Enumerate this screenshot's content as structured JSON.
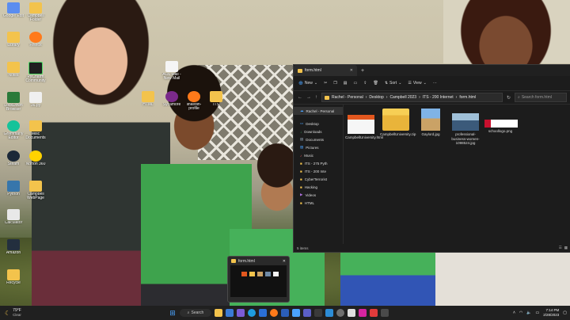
{
  "desktop": {
    "icons": [
      {
        "label": "Google Edit",
        "icon": "google-doc-icon",
        "color": "#5b8def"
      },
      {
        "label": "Campbell Folder",
        "icon": "folder-icon",
        "color": "#f3c34c"
      },
      {
        "label": "Library",
        "icon": "folder-icon",
        "color": "#f3c34c"
      },
      {
        "label": "Firefox",
        "icon": "firefox-icon",
        "color": "#ff7a1a"
      },
      {
        "label": "Notes",
        "icon": "folder-icon",
        "color": "#f3c34c"
      },
      {
        "label": "PyCharm Community",
        "icon": "pycharm-icon",
        "color": "#1f1f1f"
      },
      {
        "label": "LockDown Browser",
        "icon": "lock-icon",
        "color": "#2a7a3a"
      },
      {
        "label": "36.py",
        "icon": "python-file-icon",
        "color": "#f0f0f0"
      },
      {
        "label": "Grammarly Editor",
        "icon": "grammarly-icon",
        "color": "#15c39a"
      },
      {
        "label": "Misc Documents",
        "icon": "folder-icon",
        "color": "#f3c34c"
      },
      {
        "label": "Steam",
        "icon": "steam-icon",
        "color": "#1b2838"
      },
      {
        "label": "Norton 360",
        "icon": "norton-icon",
        "color": "#ffd200"
      },
      {
        "label": "Python",
        "icon": "python-icon",
        "color": "#3776ab"
      },
      {
        "label": "Campbell WebPage",
        "icon": "folder-icon",
        "color": "#f3c34c"
      },
      {
        "label": "Calculator",
        "icon": "calculator-icon",
        "color": "#e8e8e8"
      },
      {
        "label": "Amazon",
        "icon": "amazon-icon",
        "color": "#232f3e"
      },
      {
        "label": "Recycle",
        "icon": "recycle-bin-icon",
        "color": "#f3c34c"
      }
    ],
    "floating_icons": [
      {
        "label": "AOL Mail - New Mail",
        "icon": "aol-mail-icon",
        "color": "#f5f5f5"
      },
      {
        "label": "HTML",
        "icon": "folder-icon",
        "color": "#f3c34c"
      },
      {
        "label": "Sycamore",
        "icon": "sycamore-icon",
        "color": "#7a2a8a"
      },
      {
        "label": "linkedin-profile",
        "icon": "firefox-icon",
        "color": "#ff7a1a"
      },
      {
        "label": "ITS",
        "icon": "folder-icon",
        "color": "#f3c34c"
      }
    ]
  },
  "explorer": {
    "tab_title": "form.html",
    "commands": {
      "new": "New",
      "sort": "Sort",
      "view": "View"
    },
    "breadcrumb": [
      "Rachel - Personal",
      "Desktop",
      "Campbell 2023",
      "ITS - 200 Internet",
      "form.html"
    ],
    "search_placeholder": "Search form.html",
    "nav_items": [
      {
        "label": "Rachel - Personal",
        "icon": "cloud-icon",
        "selected": true
      },
      {
        "label": "Desktop",
        "icon": "desktop-icon"
      },
      {
        "label": "Downloads",
        "icon": "download-icon"
      },
      {
        "label": "Documents",
        "icon": "document-icon"
      },
      {
        "label": "Pictures",
        "icon": "pictures-icon"
      },
      {
        "label": "Music",
        "icon": "music-icon"
      },
      {
        "label": "ITS - 275 Pyth",
        "icon": "folder-icon"
      },
      {
        "label": "ITS - 200 Inte",
        "icon": "folder-icon"
      },
      {
        "label": "CyberTerrorist",
        "icon": "folder-icon"
      },
      {
        "label": "Hacking",
        "icon": "folder-icon"
      },
      {
        "label": "Videos",
        "icon": "videos-icon"
      },
      {
        "label": "HTML",
        "icon": "folder-icon"
      }
    ],
    "files": [
      {
        "name": "CampbellUniversity.html",
        "kind": "html-file-thumbnail"
      },
      {
        "name": "CampbellUniversity.zip",
        "kind": "zip-folder-icon"
      },
      {
        "name": "Gaylord.jpg",
        "kind": "image-thumbnail"
      },
      {
        "name": "professional-business-women-1098524.jpg",
        "kind": "image-thumbnail"
      },
      {
        "name": "schoollogo.png",
        "kind": "image-thumbnail"
      }
    ],
    "status": "5 items"
  },
  "preview": {
    "title": "form.html"
  },
  "taskbar": {
    "weather_temp": "79°F",
    "weather_cond": "Clear",
    "search_label": "Search",
    "clock_time": "7:14 PM",
    "clock_date": "2/28/2023",
    "apps": [
      "file-explorer-icon",
      "widgets-icon",
      "chat-icon",
      "edge-icon",
      "store-icon",
      "firefox-icon",
      "word-icon",
      "onedrive-icon",
      "teams-icon",
      "terminal-icon",
      "photos-icon",
      "settings-icon",
      "aol-icon",
      "instagram-icon",
      "music-icon",
      "camera-icon"
    ]
  }
}
